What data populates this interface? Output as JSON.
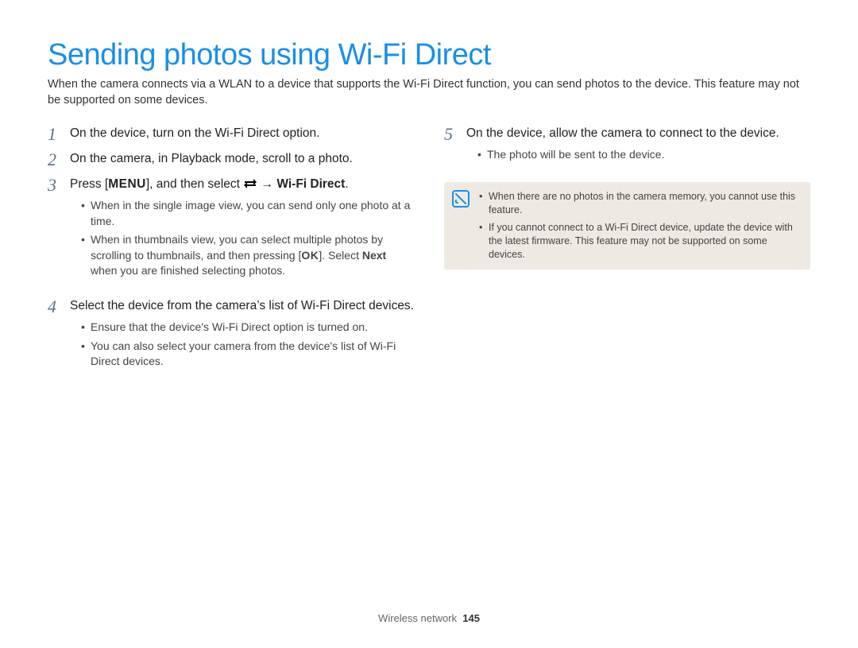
{
  "title": "Sending photos using Wi-Fi Direct",
  "intro": "When the camera connects via a WLAN to a device that supports the Wi-Fi Direct function, you can send photos to the device. This feature may not be supported on some devices.",
  "left": {
    "step1": {
      "num": "1",
      "text": "On the device, turn on the Wi-Fi Direct option."
    },
    "step2": {
      "num": "2",
      "text": "On the camera, in Playback mode, scroll to a photo."
    },
    "step3": {
      "num": "3",
      "part1": "Press [",
      "menu": "MENU",
      "part2": "], and then select ",
      "arrow": " → ",
      "bold_tail": "Wi-Fi Direct",
      "period": ".",
      "subs": [
        "When in the single image view, you can send only one photo at a time.",
        {
          "a": "When in thumbnails view, you can select multiple photos by scrolling to thumbnails, and then pressing [",
          "ok": "OK",
          "b": "]. Select ",
          "next": "Next",
          "c": " when you are finished selecting photos."
        }
      ]
    },
    "step4": {
      "num": "4",
      "text": "Select the device from the camera’s list of Wi-Fi Direct devices.",
      "subs": [
        "Ensure that the device's Wi-Fi Direct option is turned on.",
        "You can also select your camera from the device's list of Wi-Fi Direct devices."
      ]
    }
  },
  "right": {
    "step5": {
      "num": "5",
      "text": "On the device, allow the camera to connect to the device.",
      "subs": [
        "The photo will be sent to the device."
      ]
    },
    "notes": [
      "When there are no photos in the camera memory, you cannot use this feature.",
      "If you cannot connect to a Wi-Fi Direct device, update the device with the latest firmware. This feature may not be supported on some devices."
    ]
  },
  "footer": {
    "section": "Wireless network",
    "page": "145"
  }
}
